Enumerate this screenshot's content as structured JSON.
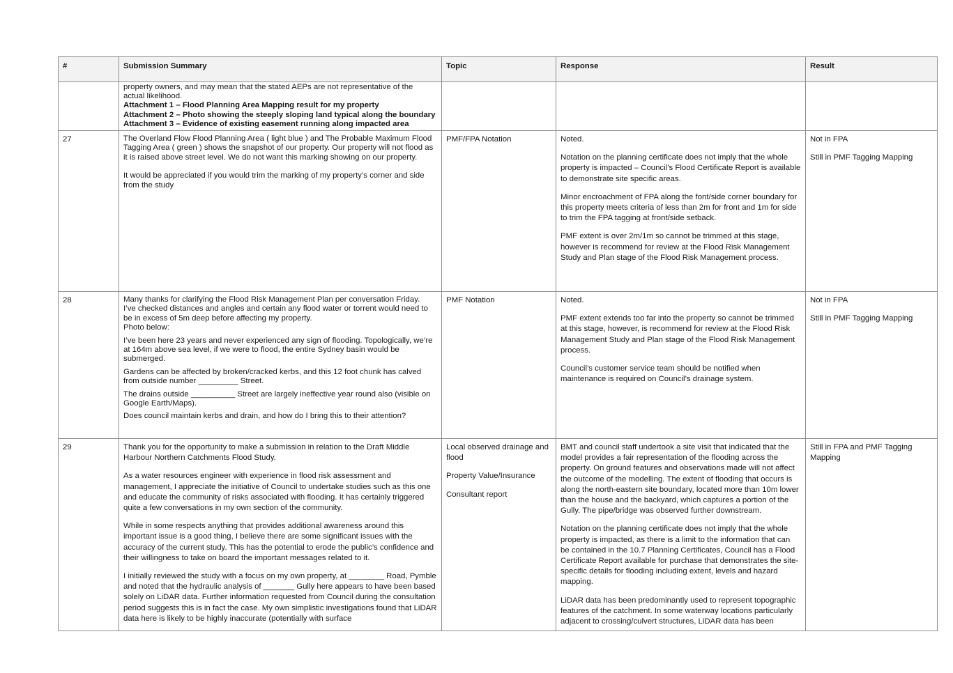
{
  "headers": [
    "#",
    "Submission Summary",
    "Topic",
    "Response",
    "Result"
  ],
  "continuation": {
    "summary_lines": [
      "property owners, and may mean that the stated AEPs are not representative of the",
      "actual likelihood."
    ],
    "attachments": [
      "Attachment 1 – Flood Planning Area Mapping result for my property",
      "Attachment 2 – Photo showing the steeply sloping land typical along the boundary",
      "Attachment 3 – Evidence of existing easement running along impacted area"
    ]
  },
  "rows": [
    {
      "num": "27",
      "summary": [
        "The Overland Flow Flood Planning Area  ( light blue ) and The Probable Maximum Flood Tagging Area ( green ) shows the snapshot of our property.  Our property will not flood as it is raised above street level.  We do not want this marking showing on our property.",
        "It would be appreciated if you would trim the marking of my property’s corner and side from the study"
      ],
      "topic": [
        "PMF/FPA Notation"
      ],
      "response": [
        "Noted.",
        "Notation on the planning certificate does not imply that the whole property is impacted – Council’s Flood Certificate Report is available to demonstrate site specific areas.",
        "Minor encroachment of FPA along the font/side corner boundary for this property meets criteria of less than 2m for front and 1m for side to trim the FPA tagging at front/side setback.",
        "PMF extent is over 2m/1m so cannot be trimmed at this stage, however is recommend for review at the Flood Risk Management Study and Plan stage of the Flood Risk Management process."
      ],
      "result": [
        "Not in FPA",
        "Still in PMF Tagging Mapping"
      ]
    },
    {
      "num": "28",
      "summary": [
        "Many thanks for clarifying the Flood Risk Management Plan per conversation Friday.",
        "I’ve checked distances and angles and certain any flood water or torrent would need to be in excess of 5m deep before affecting my property.",
        "Photo below:",
        "I’ve been here 23 years and never experienced any sign of flooding. Topologically, we’re at 164m above sea level, if we were to flood, the entire Sydney basin would be submerged.",
        "Gardens can be affected by broken/cracked kerbs, and this 12 foot chunk has calved from outside number _________ Street.",
        "The drains outside __________ Street are largely ineffective year round also (visible on Google Earth/Maps).",
        "Does council maintain kerbs and drain, and how do I bring this to their attention?"
      ],
      "topic": [
        "PMF Notation"
      ],
      "response": [
        "Noted.",
        "PMF extent extends too far into the property so cannot be trimmed at this stage, however, is recommend for review at the Flood Risk Management Study and Plan stage of the Flood Risk Management process.",
        "Council’s customer service team should be notified when maintenance is required on Council’s drainage system."
      ],
      "result": [
        "Not in FPA",
        "Still in PMF Tagging Mapping"
      ]
    },
    {
      "num": "29",
      "summary": [
        "Thank you for the opportunity to make a submission in relation to the Draft Middle Harbour Northern Catchments Flood Study.",
        "As a water resources engineer with experience in flood risk assessment and management, I appreciate the initiative of Council to undertake studies such as this one and educate the community of risks associated with flooding. It has certainly triggered quite a few conversations in my own section of the community.",
        "While in some respects anything that provides additional awareness around this important issue is a good thing, I believe there are some significant issues with the accuracy of the current study. This has the potential to erode the public’s confidence and their willingness to take on board the important messages related to it.",
        "I initially reviewed the study with a focus on my own property, at ________ Road, Pymble and noted that the hydraulic analysis of _______ Gully here appears to have been based solely on LiDAR data. Further information requested from Council during the consultation period suggests this is in fact the case. My own simplistic investigations found that LiDAR data here is likely to be highly inaccurate (potentially with surface"
      ],
      "topic": [
        "Local observed drainage and flood",
        "Property Value/Insurance",
        "Consultant report"
      ],
      "response": [
        "BMT and council staff undertook a site visit that indicated that the model provides a fair representation of the flooding across the property. On ground features and observations made will not affect the outcome of the modelling. The extent of flooding that occurs is along the north-eastern site boundary, located more than 10m lower than the house and the backyard, which captures a portion of the Gully. The pipe/bridge was observed further downstream.",
        "Notation on the planning certificate does not imply that the whole property is impacted, as there is a limit to the information that can be contained in the 10.7 Planning Certificates, Council has a Flood Certificate Report available for purchase that demonstrates the site-specific details for flooding including extent, levels and hazard mapping.",
        "LiDAR data has been predominantly used to represent topographic features of the catchment. In some waterway locations particularly adjacent to crossing/culvert structures, LiDAR data has been"
      ],
      "result": [
        "Still in FPA and PMF Tagging Mapping"
      ]
    }
  ]
}
